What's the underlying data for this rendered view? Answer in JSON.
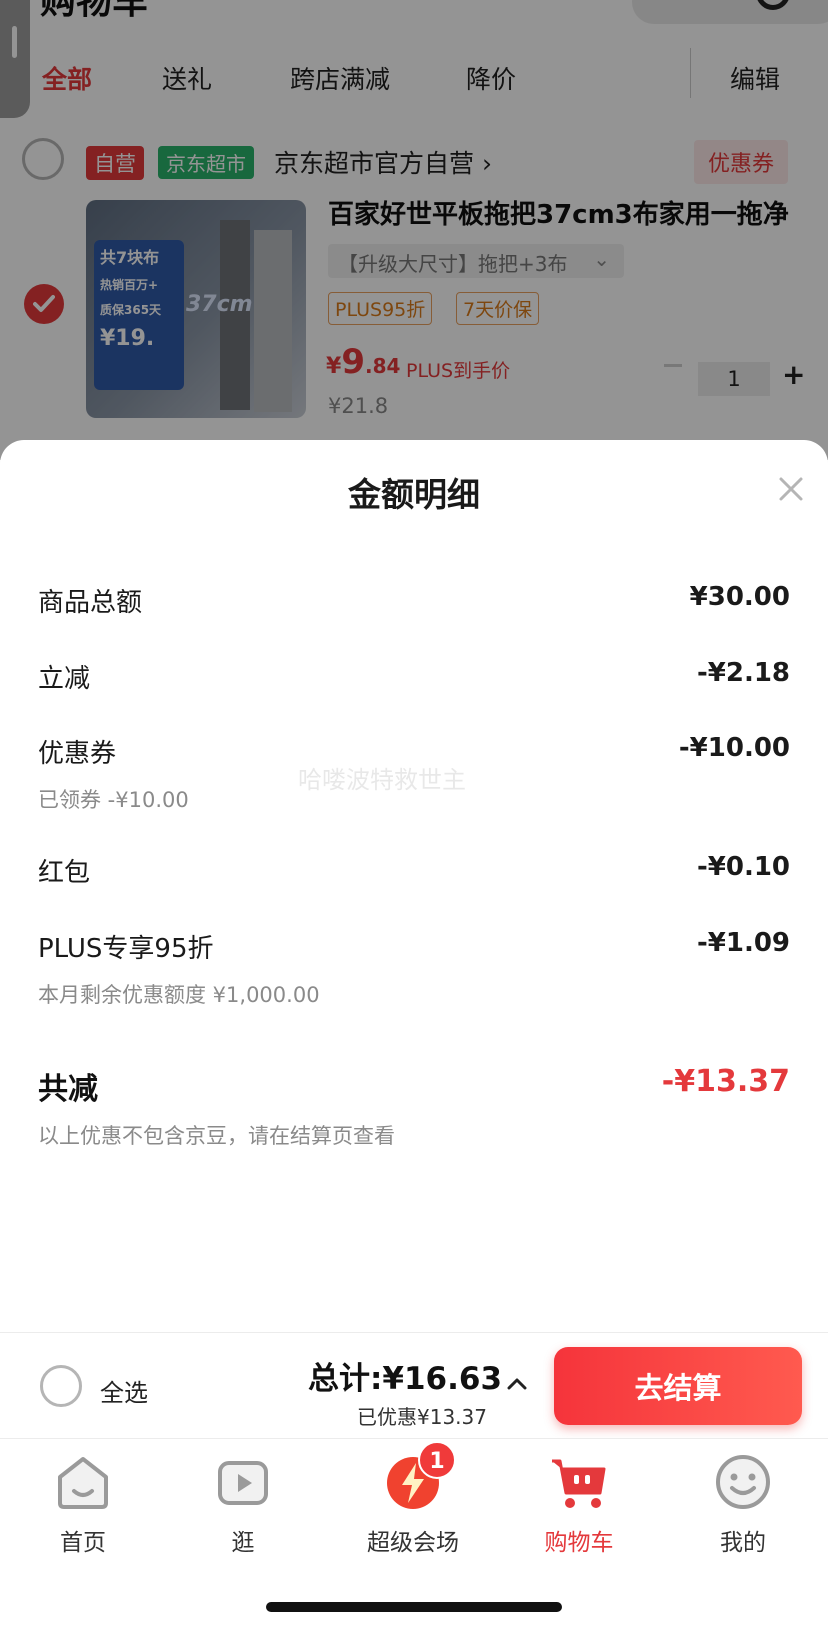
{
  "header": {
    "title": "购物车"
  },
  "filters": {
    "tabs": [
      "全部",
      "送礼",
      "跨店满减",
      "降价"
    ],
    "edit_label": "编辑"
  },
  "store": {
    "badge_self": "自营",
    "badge_supermarket": "京东超市",
    "name": "京东超市官方自营 ›",
    "coupon_label": "优惠券"
  },
  "product": {
    "title": "百家好世平板拖把37cm3布家用一拖净",
    "variant": "【升级大尺寸】拖把+3布",
    "badges": [
      "PLUS95折",
      "7天价保"
    ],
    "price_symbol": "¥",
    "price_int": "9",
    "price_dec": ".84",
    "plus_price_label": "PLUS到手价",
    "original_price": "¥21.8",
    "quantity": "1",
    "image_text": {
      "line1": "共7块布",
      "line2": "热销百万+",
      "line3": "质保365天",
      "price": "¥19.",
      "size": "37cm"
    }
  },
  "sheet": {
    "title": "金额明细",
    "rows": [
      {
        "label": "商品总额",
        "value": "¥30.00"
      },
      {
        "label": "立减",
        "value": "-¥2.18"
      },
      {
        "label": "优惠券",
        "value": "-¥10.00",
        "sub": "已领券 -¥10.00"
      },
      {
        "label": "红包",
        "value": "-¥0.10"
      },
      {
        "label": "PLUS专享95折",
        "value": "-¥1.09",
        "sub": "本月剩余优惠额度 ¥1,000.00"
      }
    ],
    "total_label": "共减",
    "total_value": "-¥13.37",
    "note": "以上优惠不包含京豆，请在结算页查看",
    "watermark": "哈喽波特救世主"
  },
  "checkout": {
    "select_all_label": "全选",
    "total_text": "总计:¥16.63",
    "saved_text": "已优惠¥13.37",
    "checkout_button": "去结算"
  },
  "tabbar": {
    "items": [
      {
        "label": "首页",
        "icon": "home-icon"
      },
      {
        "label": "逛",
        "icon": "video-play-icon"
      },
      {
        "label": "超级会场",
        "icon": "super-venue-icon",
        "badge": "1"
      },
      {
        "label": "购物车",
        "icon": "shopping-cart-icon"
      },
      {
        "label": "我的",
        "icon": "smiley-profile-icon"
      }
    ],
    "active_index": 3
  },
  "colors": {
    "accent": "#e4393c",
    "supermarket_green": "#2ab36b",
    "plus_badge": "#d97a1a"
  }
}
